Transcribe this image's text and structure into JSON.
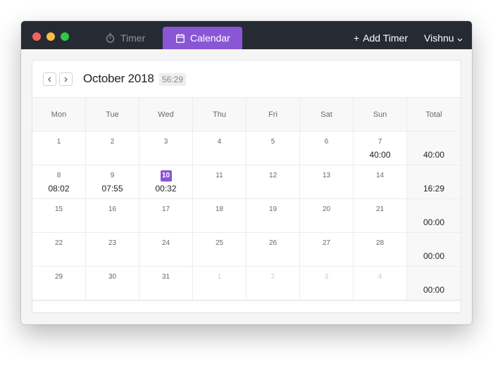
{
  "colors": {
    "accent": "#8a56d6",
    "titlebar": "#262a33"
  },
  "titlebar": {
    "tabs": [
      {
        "label": "Timer",
        "icon": "stopwatch-icon",
        "active": false
      },
      {
        "label": "Calendar",
        "icon": "calendar-icon",
        "active": true
      }
    ],
    "add_timer": {
      "plus": "+",
      "label": "Add Timer"
    },
    "user": {
      "name": "Vishnu",
      "icon": "chevron-down-icon"
    }
  },
  "calendar": {
    "month_label": "October 2018",
    "month_total": "56:29",
    "headers": [
      "Mon",
      "Tue",
      "Wed",
      "Thu",
      "Fri",
      "Sat",
      "Sun",
      "Total"
    ],
    "weeks": [
      {
        "days": [
          {
            "d": "1",
            "t": ""
          },
          {
            "d": "2",
            "t": ""
          },
          {
            "d": "3",
            "t": ""
          },
          {
            "d": "4",
            "t": ""
          },
          {
            "d": "5",
            "t": ""
          },
          {
            "d": "6",
            "t": ""
          },
          {
            "d": "7",
            "t": "40:00"
          }
        ],
        "total": "40:00"
      },
      {
        "days": [
          {
            "d": "8",
            "t": "08:02"
          },
          {
            "d": "9",
            "t": "07:55"
          },
          {
            "d": "10",
            "t": "00:32",
            "today": true
          },
          {
            "d": "11",
            "t": ""
          },
          {
            "d": "12",
            "t": ""
          },
          {
            "d": "13",
            "t": ""
          },
          {
            "d": "14",
            "t": ""
          }
        ],
        "total": "16:29"
      },
      {
        "days": [
          {
            "d": "15",
            "t": ""
          },
          {
            "d": "16",
            "t": ""
          },
          {
            "d": "17",
            "t": ""
          },
          {
            "d": "18",
            "t": ""
          },
          {
            "d": "19",
            "t": ""
          },
          {
            "d": "20",
            "t": ""
          },
          {
            "d": "21",
            "t": ""
          }
        ],
        "total": "00:00"
      },
      {
        "days": [
          {
            "d": "22",
            "t": ""
          },
          {
            "d": "23",
            "t": ""
          },
          {
            "d": "24",
            "t": ""
          },
          {
            "d": "25",
            "t": ""
          },
          {
            "d": "26",
            "t": ""
          },
          {
            "d": "27",
            "t": ""
          },
          {
            "d": "28",
            "t": ""
          }
        ],
        "total": "00:00"
      },
      {
        "days": [
          {
            "d": "29",
            "t": ""
          },
          {
            "d": "30",
            "t": ""
          },
          {
            "d": "31",
            "t": ""
          },
          {
            "d": "1",
            "t": "",
            "outside": true
          },
          {
            "d": "2",
            "t": "",
            "outside": true
          },
          {
            "d": "3",
            "t": "",
            "outside": true
          },
          {
            "d": "4",
            "t": "",
            "outside": true
          }
        ],
        "total": "00:00"
      }
    ]
  }
}
